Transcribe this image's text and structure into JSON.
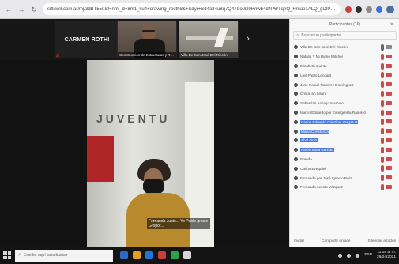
{
  "browser": {
    "url": "sifluvel.com.ar/mj/3dBT550&f=nmi_d=8m1_ku4+drawing_rooth8&+&dyr+Sd4a84u8q7Q4Tbo0D9Rnwb4d4P6/TqnQ_Hmap1ALQ_gDIPvt4D"
  },
  "thumbnails": {
    "active_name": "CARMEN ROTHI",
    "video1_label": "Construcción de Estructuras y Re...",
    "video2_label": "Villa De San José Del Rincón",
    "next_icon": "chevron-right-icon"
  },
  "main": {
    "wall_text": "JUVENTU",
    "caption": "Fernanda Justo... Yo Pablo gracio Gropor..."
  },
  "panel": {
    "title": "Participantes (16)",
    "search_placeholder": "Buscar un participante",
    "footer_left": "Invitar",
    "footer_center": "Compartir enlace",
    "footer_right": "Silenciar a todos",
    "participants": [
      {
        "name": "Villa De San José Del Rincón",
        "highlight": false,
        "mic": "gray",
        "cam": "gray"
      },
      {
        "name": "Natalia Y Mi Diario Mitchel",
        "highlight": false,
        "mic": "red",
        "cam": "red"
      },
      {
        "name": "Elizabeth Quinto",
        "highlight": false,
        "mic": "red",
        "cam": "red"
      },
      {
        "name": "Luis Pablo Lecoaut",
        "highlight": false,
        "mic": "red",
        "cam": "red"
      },
      {
        "name": "José Rafael Ramírez Domínguez",
        "highlight": false,
        "mic": "red",
        "cam": "red"
      },
      {
        "name": "Crista Ian Lilian",
        "highlight": false,
        "mic": "red",
        "cam": "red"
      },
      {
        "name": "Sebastián Antiago Marcelo",
        "highlight": false,
        "mic": "red",
        "cam": "red"
      },
      {
        "name": "Martín Eduardo por Evangelista Ramírez",
        "highlight": false,
        "mic": "red",
        "cam": "red"
      },
      {
        "name": "Carlos Eduardo Cristóbal Vargas R",
        "highlight": true,
        "mic": "red",
        "cam": "red"
      },
      {
        "name": "María Constanza",
        "highlight": true,
        "mic": "red",
        "cam": "red"
      },
      {
        "name": "Abril Ortiz",
        "highlight": true,
        "mic": "red",
        "cam": "red"
      },
      {
        "name": "Aarón Sosa Garrido",
        "highlight": true,
        "mic": "red",
        "cam": "red"
      },
      {
        "name": "Brenda",
        "highlight": false,
        "mic": "red",
        "cam": "red"
      },
      {
        "name": "Carlos Ezequiel",
        "highlight": false,
        "mic": "red",
        "cam": "red"
      },
      {
        "name": "Fernanda por José Ignacio Ruiz",
        "highlight": false,
        "mic": "red",
        "cam": "red"
      },
      {
        "name": "Fernanda Acosta Vázquez",
        "highlight": false,
        "mic": "red",
        "cam": "red"
      }
    ]
  },
  "taskbar": {
    "search_text": "Escribe aquí para buscar",
    "time": "11:18 a. m.",
    "date": "26/04/2021",
    "lang": "ESP"
  },
  "colors": {
    "highlight": "#4c7bdf",
    "dark_bg": "#121212",
    "panel_bg": "#f7f7f7",
    "mic_red": "#c64b4b"
  }
}
